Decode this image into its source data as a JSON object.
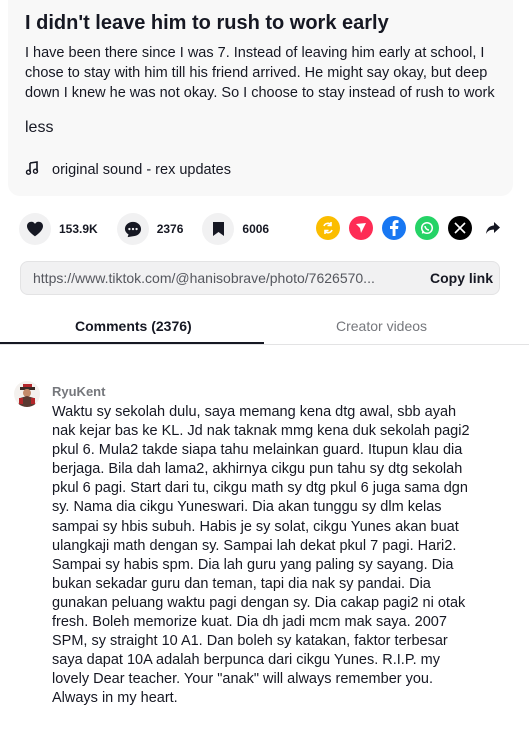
{
  "post": {
    "title": "I didn't leave him to rush to work early",
    "description": "I have been there since I was 7. Instead of leaving him early at school, I chose to stay with him till his friend arrived. He might say okay, but deep down I knew he was not okay. So I choose to stay instead of rush to work",
    "less_label": "less",
    "music_icon": "music-note-icon",
    "music": "original sound - rex updates"
  },
  "actions": {
    "likes": "153.9K",
    "comments": "2376",
    "saves": "6006"
  },
  "share": {
    "icons": [
      "embed-icon",
      "send-icon",
      "facebook-icon",
      "whatsapp-icon",
      "x-icon",
      "share-arrow-icon"
    ],
    "colors": {
      "embed": "#fbbd00",
      "send": "#fe2c55",
      "facebook": "#1877f2",
      "whatsapp": "#25d366",
      "x": "#000000"
    }
  },
  "link": {
    "url": "https://www.tiktok.com/@hanisobrave/photo/7626570...",
    "copy_label": "Copy link"
  },
  "tabs": {
    "comments": "Comments (2376)",
    "creator": "Creator videos"
  },
  "comment": {
    "username": "RyuKent",
    "text": "Waktu sy sekolah dulu, saya memang kena dtg awal, sbb ayah nak kejar bas ke KL. Jd nak taknak mmg kena duk sekolah pagi2 pkul 6. Mula2 takde siapa tahu melainkan guard. Itupun klau dia berjaga. Bila dah lama2, akhirnya cikgu pun tahu sy dtg sekolah pkul 6 pagi. Start dari tu, cikgu math sy dtg pkul 6 juga sama dgn sy. Nama dia cikgu Yuneswari. Dia akan tunggu sy dlm kelas sampai sy hbis subuh. Habis je sy solat, cikgu Yunes akan buat ulangkaji math dengan sy. Sampai lah dekat pkul 7 pagi. Hari2. Sampai sy habis spm. Dia lah guru yang paling sy sayang. Dia bukan sekadar guru dan teman, tapi dia nak sy pandai. Dia gunakan peluang waktu pagi dengan sy. Dia cakap pagi2 ni otak fresh. Boleh memorize kuat. Dia dh jadi mcm mak saya. 2007 SPM, sy straight 10 A1. Dan boleh sy katakan, faktor terbesar saya dapat 10A adalah berpunca dari cikgu Yunes. R.I.P. my lovely Dear teacher. Your \"anak\" will always remember you. Always in my heart."
  }
}
